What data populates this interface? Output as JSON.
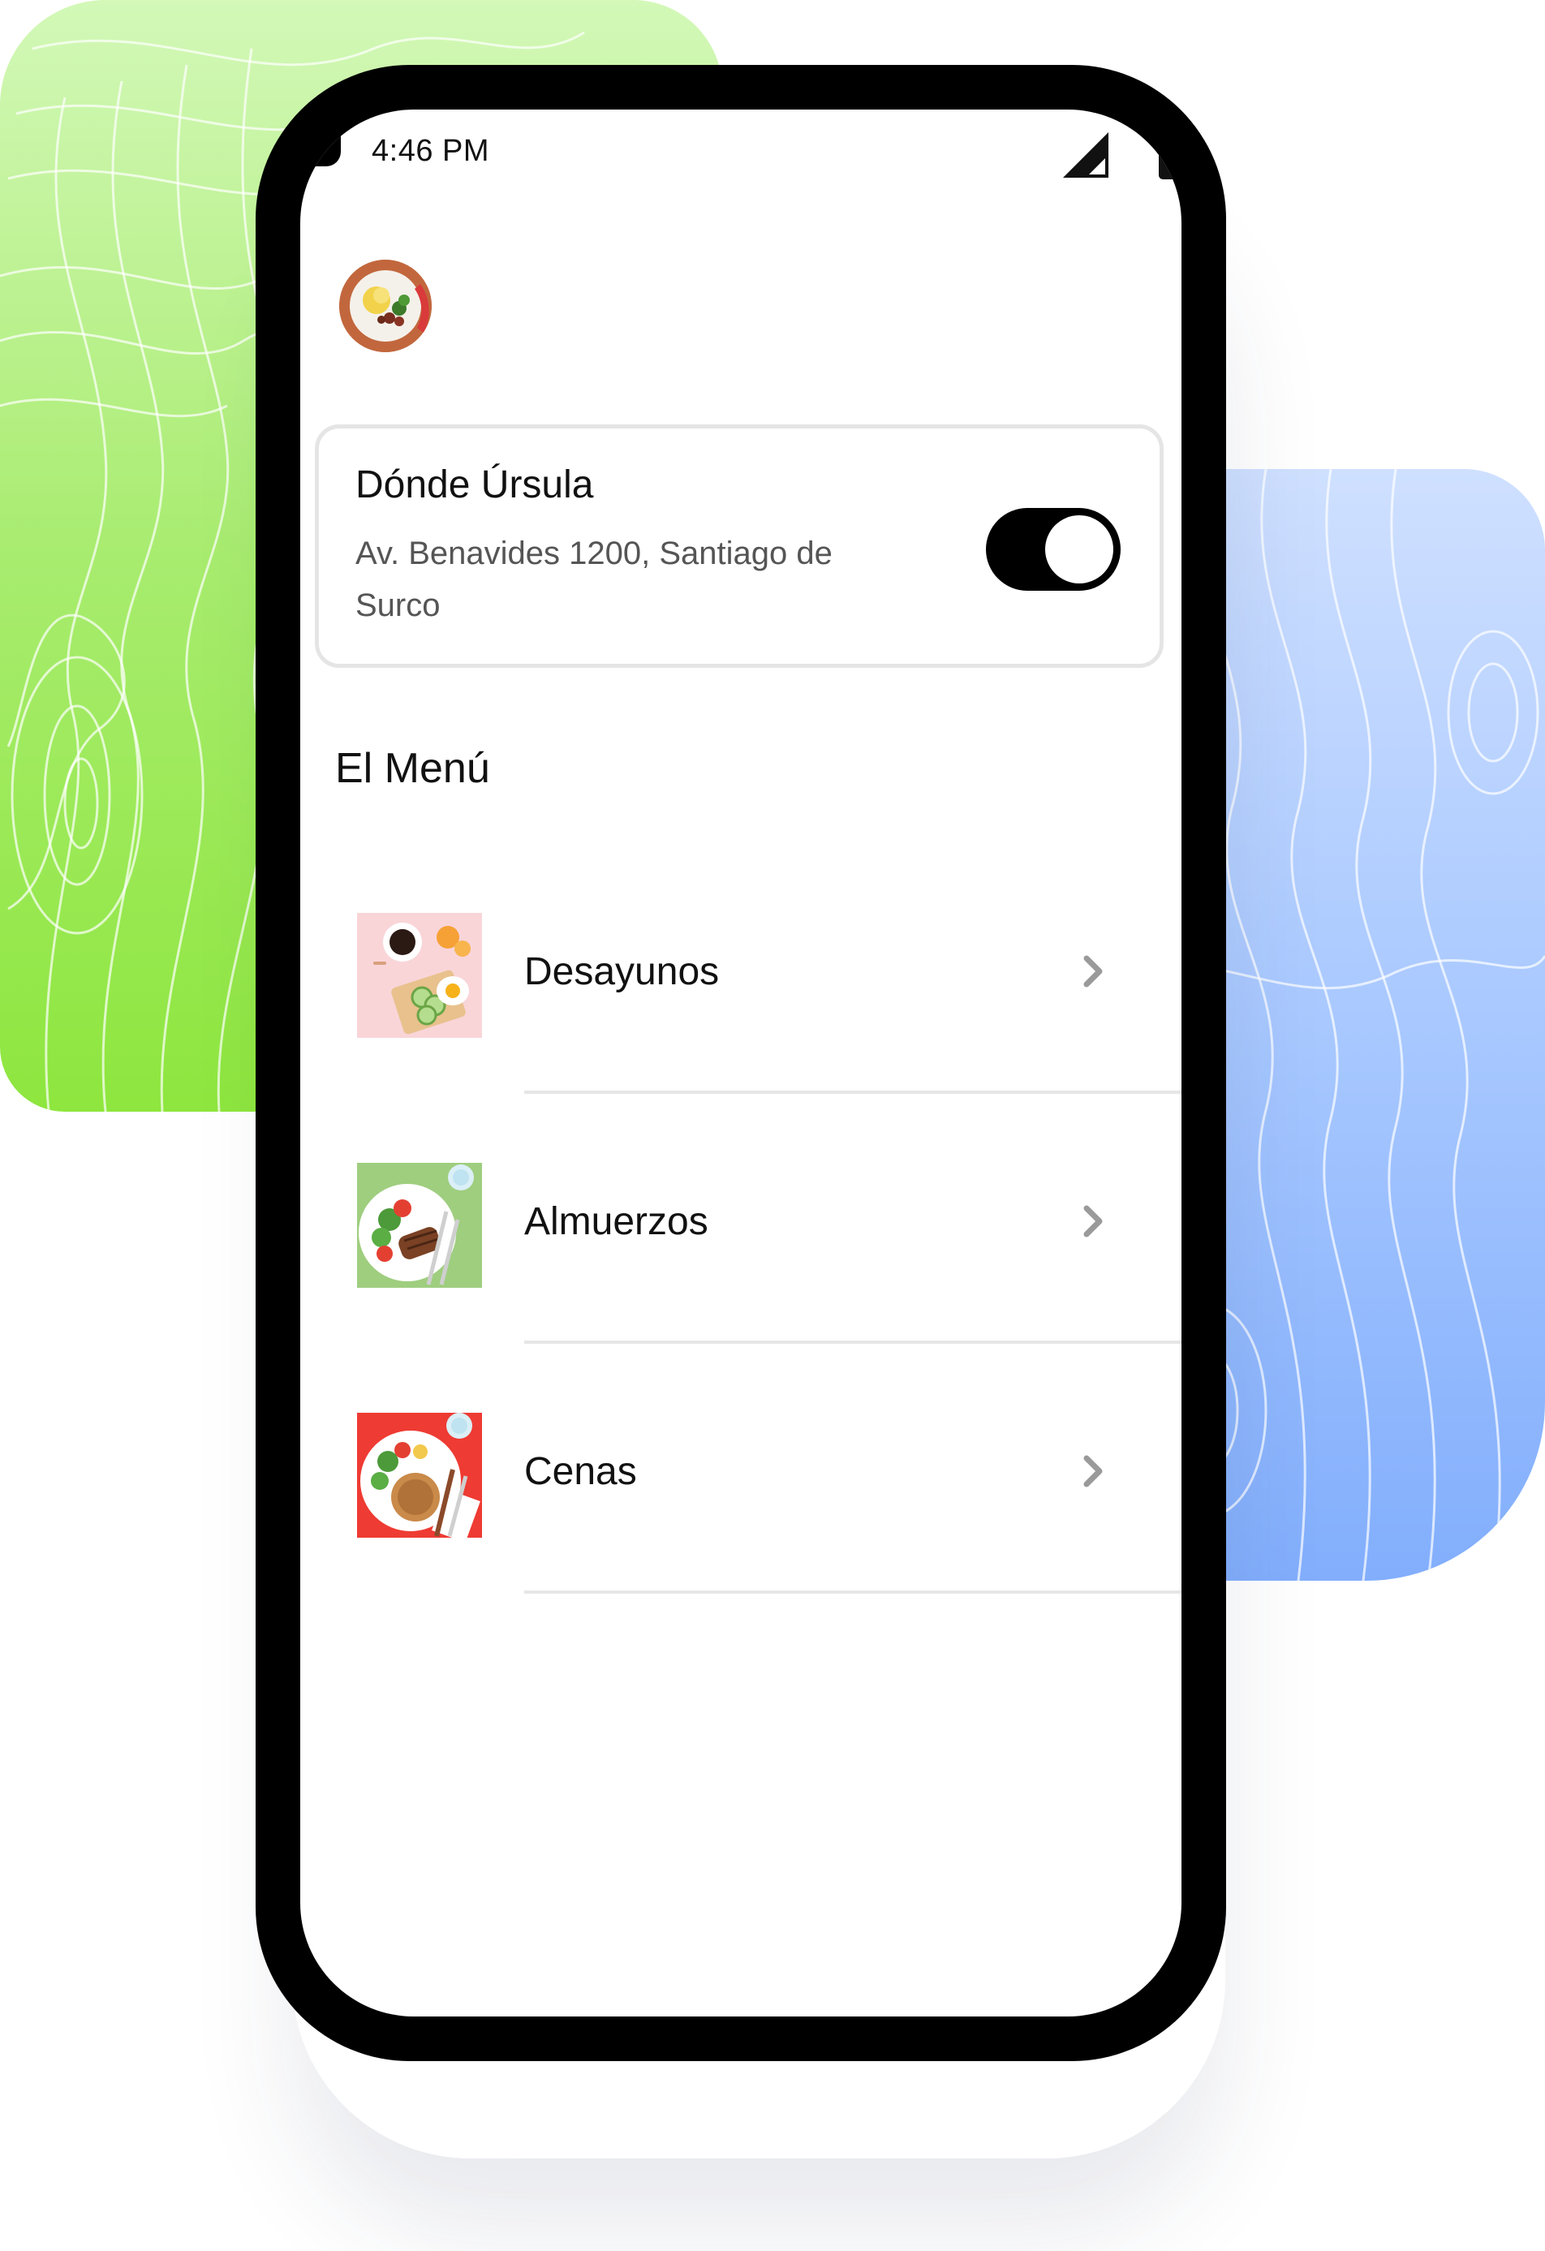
{
  "status_bar": {
    "time": "4:46 PM",
    "signal_icon": "cell-signal-icon",
    "battery_icon": "battery-icon"
  },
  "restaurant": {
    "name": "Dónde Úrsula",
    "address": "Av. Benavides 1200, Santiago de Surco",
    "open": true
  },
  "menu": {
    "title": "El Menú",
    "items": [
      {
        "label": "Desayunos",
        "thumb": "breakfast-thumbnail",
        "thumb_bg": "#f9d5d8"
      },
      {
        "label": "Almuerzos",
        "thumb": "lunch-thumbnail",
        "thumb_bg": "#9fce7f"
      },
      {
        "label": "Cenas",
        "thumb": "dinner-thumbnail",
        "thumb_bg": "#ee3b33"
      }
    ]
  },
  "colors": {
    "toggle_on": "#000000",
    "card_border": "#e5e5e5",
    "divider": "#e6e6e6",
    "chevron": "#9a9a9a",
    "bg_green": "#a8ec6f",
    "bg_blue": "#a8c8ff"
  }
}
